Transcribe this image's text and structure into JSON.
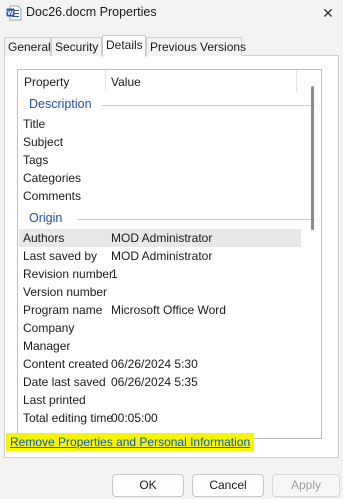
{
  "window": {
    "title": "Doc26.docm Properties",
    "close_glyph": "✕"
  },
  "tabs": [
    {
      "label": "General"
    },
    {
      "label": "Security"
    },
    {
      "label": "Details"
    },
    {
      "label": "Previous Versions"
    }
  ],
  "columns": {
    "property": "Property",
    "value": "Value"
  },
  "groups": [
    {
      "title": "Description",
      "rows": [
        {
          "prop": "Title",
          "val": ""
        },
        {
          "prop": "Subject",
          "val": ""
        },
        {
          "prop": "Tags",
          "val": ""
        },
        {
          "prop": "Categories",
          "val": ""
        },
        {
          "prop": "Comments",
          "val": ""
        }
      ]
    },
    {
      "title": "Origin",
      "rows": [
        {
          "prop": "Authors",
          "val": "MOD Administrator",
          "selected": true
        },
        {
          "prop": "Last saved by",
          "val": "MOD Administrator"
        },
        {
          "prop": "Revision number",
          "val": "1"
        },
        {
          "prop": "Version number",
          "val": ""
        },
        {
          "prop": "Program name",
          "val": "Microsoft Office Word"
        },
        {
          "prop": "Company",
          "val": ""
        },
        {
          "prop": "Manager",
          "val": ""
        },
        {
          "prop": "Content created",
          "val": "06/26/2024 5:30"
        },
        {
          "prop": "Date last saved",
          "val": "06/26/2024 5:35"
        },
        {
          "prop": "Last printed",
          "val": ""
        },
        {
          "prop": "Total editing time",
          "val": "00:05:00"
        }
      ]
    }
  ],
  "remove_link": "Remove Properties and Personal Information",
  "buttons": {
    "ok": "OK",
    "cancel": "Cancel",
    "apply": "Apply"
  },
  "colors": {
    "group_title": "#1f4e9e",
    "link": "#0b57c8",
    "link_highlight": "#f6f400",
    "word_blue": "#2b579a"
  },
  "icons": {
    "app": "word-doc-icon",
    "close": "close-icon"
  }
}
